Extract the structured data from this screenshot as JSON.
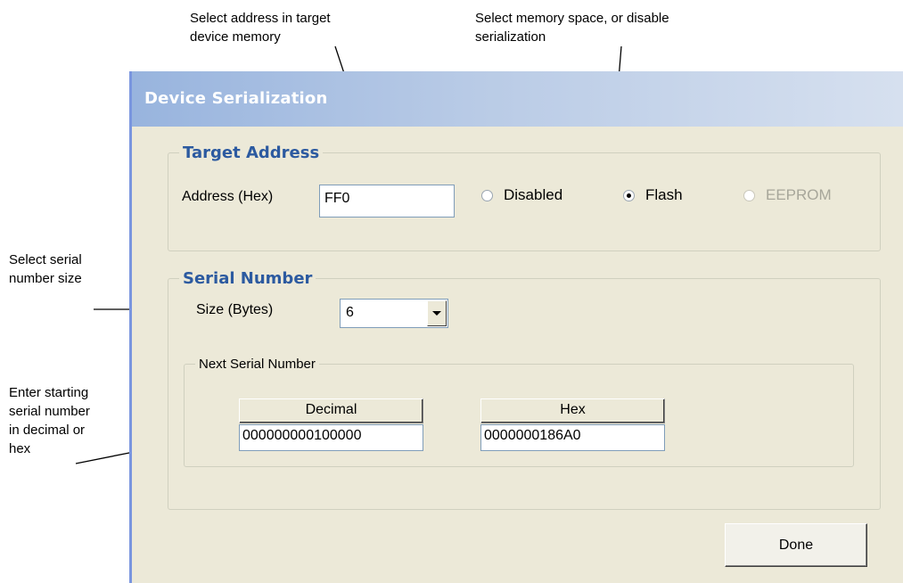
{
  "callouts": {
    "address_select": "Select address in target\ndevice memory",
    "memory_space": "Select memory space, or disable\nserialization",
    "serial_size": "Select serial\nnumber size",
    "enter_serial": "Enter starting\nserial number\nin decimal or\nhex"
  },
  "dialog": {
    "title": "Device Serialization",
    "target_address": {
      "legend": "Target Address",
      "address_label": "Address (Hex)",
      "address_value": "FF0",
      "radios": [
        {
          "label": "Disabled",
          "checked": false,
          "enabled": true
        },
        {
          "label": "Flash",
          "checked": true,
          "enabled": true
        },
        {
          "label": "EEPROM",
          "checked": false,
          "enabled": false
        }
      ]
    },
    "serial_number": {
      "legend": "Serial Number",
      "size_label": "Size (Bytes)",
      "size_value": "6",
      "next": {
        "legend": "Next Serial Number",
        "decimal_header": "Decimal",
        "decimal_value": "000000000100000",
        "hex_header": "Hex",
        "hex_value": "0000000186A0"
      }
    },
    "done_label": "Done"
  }
}
